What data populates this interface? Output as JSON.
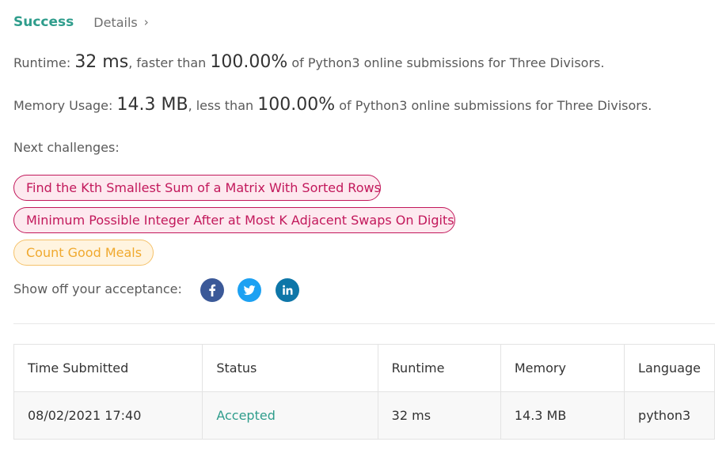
{
  "tabs": {
    "success": "Success",
    "details": "Details",
    "details_chevron": "›"
  },
  "runtime": {
    "label": "Runtime:",
    "value": "32 ms",
    "comparison": ", faster than",
    "percent": "100.00%",
    "suffix": "of Python3 online submissions for Three Divisors."
  },
  "memory": {
    "label": "Memory Usage:",
    "value": "14.3 MB",
    "comparison": ", less than",
    "percent": "100.00%",
    "suffix": "of Python3 online submissions for Three Divisors."
  },
  "next_challenges": {
    "label": "Next challenges:",
    "items": [
      {
        "title": "Find the Kth Smallest Sum of a Matrix With Sorted Rows",
        "difficulty_color": "#c2185b"
      },
      {
        "title": "Minimum Possible Integer After at Most K Adjacent Swaps On Digits",
        "difficulty_color": "#c2185b"
      },
      {
        "title": "Count Good Meals",
        "difficulty_color": "#f0a92e"
      }
    ]
  },
  "share": {
    "label": "Show off your acceptance:",
    "icons": [
      "facebook-icon",
      "twitter-icon",
      "linkedin-icon"
    ]
  },
  "table": {
    "headers": [
      "Time Submitted",
      "Status",
      "Runtime",
      "Memory",
      "Language"
    ],
    "rows": [
      [
        "08/02/2021 17:40",
        "Accepted",
        "32 ms",
        "14.3 MB",
        "python3"
      ]
    ]
  },
  "colors": {
    "success": "#2f9d8c",
    "hard": "#c2185b",
    "easy": "#f0a92e"
  }
}
